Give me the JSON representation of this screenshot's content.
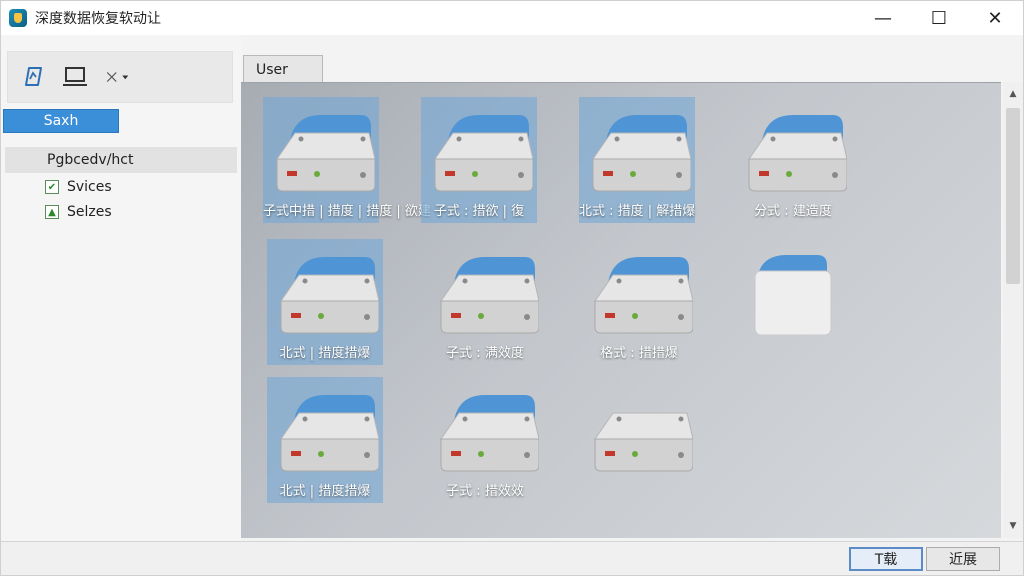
{
  "window": {
    "title": "深度数据恢复软动让",
    "controls": {
      "minimize": "—",
      "maximize": "☐",
      "close": "✕"
    }
  },
  "left_panel": {
    "search_button": "Saxh",
    "tree": {
      "header": "Pgbcedv/hct",
      "items": [
        {
          "label": "Svices"
        },
        {
          "label": "Selzes"
        }
      ]
    }
  },
  "tab": {
    "label": "User"
  },
  "drives": [
    {
      "label": "子式中措 | 措度 | 措度 | 欲建",
      "selected": true
    },
    {
      "label": "子式 : 措欲 | 復",
      "selected": true
    },
    {
      "label": "北式 : 措度 | 解措爆",
      "selected": true
    },
    {
      "label": "分式 : 建造度",
      "selected": false
    },
    {
      "label": "北式 | 措度措爆",
      "selected": true
    },
    {
      "label": "子式 : 满效度",
      "selected": false
    },
    {
      "label": "格式 : 措措爆",
      "selected": false
    },
    {
      "label": "",
      "selected": false,
      "type": "blank"
    },
    {
      "label": "北式 | 措度措爆",
      "selected": true
    },
    {
      "label": "子式 : 措效效",
      "selected": false
    },
    {
      "label": "",
      "selected": false,
      "type": "plain"
    }
  ],
  "buttons": {
    "primary": "T载",
    "secondary": "近展"
  },
  "colors": {
    "accent": "#3b8fd9",
    "selection": "#6ea5d7"
  }
}
